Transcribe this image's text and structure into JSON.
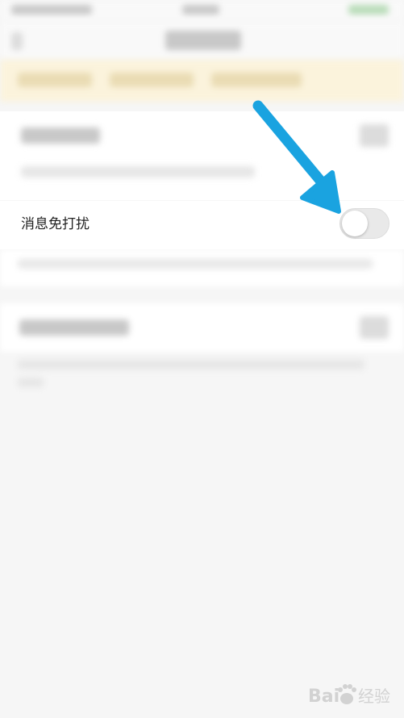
{
  "setting": {
    "label": "消息免打扰",
    "toggle_on": false
  },
  "annotation": {
    "arrow_color": "#1aa3e0"
  },
  "watermark": {
    "text": "Bai 经验",
    "brand_color": "#cfcfcf"
  },
  "colors": {
    "background": "#f6f6f6",
    "banner": "#fbf3dc",
    "toggle_off": "#e9e9e9"
  }
}
